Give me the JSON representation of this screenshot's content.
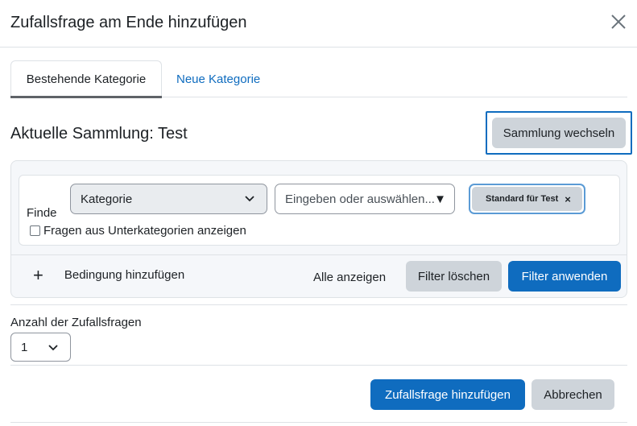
{
  "modal": {
    "title": "Zufallsfrage am Ende hinzufügen"
  },
  "tabs": [
    {
      "label": "Bestehende Kategorie",
      "active": true
    },
    {
      "label": "Neue Kategorie",
      "active": false
    }
  ],
  "collection": {
    "heading": "Aktuelle Sammlung: Test",
    "switch_label": "Sammlung wechseln"
  },
  "filter": {
    "find_label": "Finde",
    "condition_type": "Kategorie",
    "search_placeholder": "Eingeben oder auswählen...",
    "search_arrow": "▼",
    "selected_chip": "Standard für Test",
    "chip_remove": "×",
    "subcategories_label": "Fragen aus Unterkategorien anzeigen",
    "subcategories_checked": false,
    "add_condition_label": "Bedingung hinzufügen",
    "show_all_label": "Alle anzeigen",
    "clear_label": "Filter löschen",
    "apply_label": "Filter anwenden"
  },
  "random_count": {
    "label": "Anzahl der Zufallsfragen",
    "value": "1"
  },
  "footer": {
    "add_label": "Zufallsfrage hinzufügen",
    "cancel_label": "Abbrechen"
  },
  "colors": {
    "primary": "#0f6cbf",
    "secondary": "#ced4da",
    "border": "#dee2e6",
    "text": "#1d2125"
  },
  "icons": {
    "close": "close-icon",
    "chevron": "chevron-down-icon",
    "plus": "plus-icon"
  }
}
